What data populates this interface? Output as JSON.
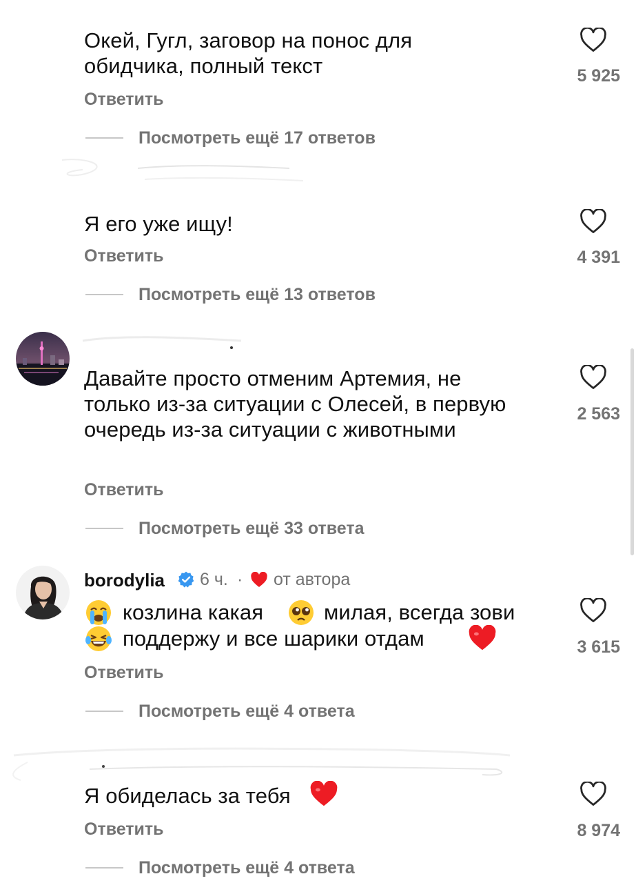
{
  "reply_label": "Ответить",
  "comments": [
    {
      "text": "Окей, Гугл, заговор на понос для обидчика, полный текст",
      "likes": "5 925",
      "view_more": "Посмотреть ещё 17 ответов"
    },
    {
      "text": "Я его уже ищу!",
      "likes": "4 391",
      "view_more": "Посмотреть ещё 13 ответов"
    },
    {
      "text": "Давайте просто отменим Артемия, не только из-за ситуации с Олесей, в первую очередь из-за ситуации с животными",
      "likes": "2 563",
      "view_more": "Посмотреть ещё 33 ответа"
    },
    {
      "username": "borodylia",
      "time": "6 ч.",
      "author_label": "от автора",
      "text_part1": "козлина какая",
      "text_part2": "милая, всегда зови",
      "text_part3": "поддержу и все шарики отдам",
      "likes": "3 615",
      "view_more": "Посмотреть ещё 4 ответа"
    },
    {
      "text": "Я обиделась за тебя",
      "likes": "8 974",
      "view_more": "Посмотреть ещё 4 ответа"
    }
  ],
  "colors": {
    "secondary": "#737373",
    "line": "#c7c7c7",
    "verified": "#3897f0",
    "heart_red": "#ed1c24"
  },
  "icons": [
    "heart-outline-icon",
    "verified-badge-icon",
    "crying-laughing-emoji",
    "pleading-face-emoji",
    "red-heart-emoji",
    "sobbing-face-emoji"
  ]
}
